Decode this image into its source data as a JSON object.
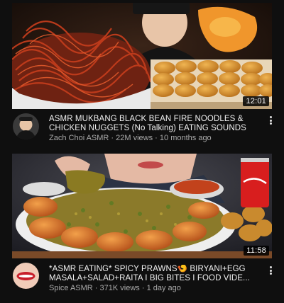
{
  "videos": [
    {
      "title": "ASMR MUKBANG BLACK BEAN FIRE NOODLES & CHICKEN NUGGETS (No Talking) EATING SOUNDS",
      "channel": "Zach Choi ASMR",
      "views": "22M views",
      "age": "10 months ago",
      "duration": "12:01",
      "thumbnail_icon": "noodles-nuggets-thumbnail",
      "avatar_icon": "channel-avatar-icon"
    },
    {
      "title": "*ASMR EATING* SPICY PRAWNS🍤 BIRYANI+EGG MASALA+SALAD+RAITA I BIG BITES I FOOD VIDE...",
      "channel": "Spice ASMR",
      "views": "371K views",
      "age": "1 day ago",
      "duration": "11:58",
      "thumbnail_icon": "prawns-biryani-thumbnail",
      "avatar_icon": "channel-avatar-icon"
    }
  ],
  "separator": " · ",
  "colors": {
    "background": "#0f0f0f",
    "title": "#f1f1f1",
    "secondary": "#aaaaaa"
  }
}
